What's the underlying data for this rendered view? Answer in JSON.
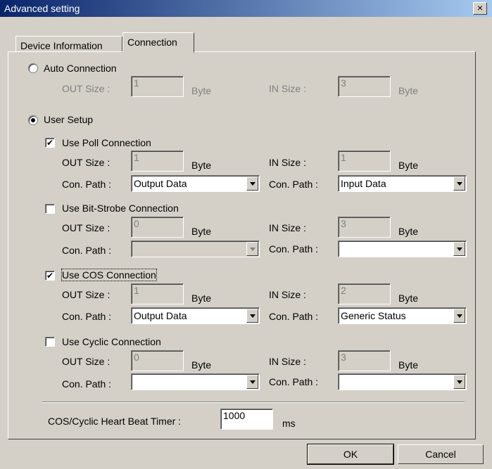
{
  "window": {
    "title": "Advanced setting",
    "close_label": "×"
  },
  "tabs": [
    {
      "label": "Device Information"
    },
    {
      "label": "Connection"
    }
  ],
  "auto": {
    "label": "Auto Connection",
    "selected": false,
    "out_label": "OUT Size :",
    "out_value": "1",
    "out_unit": "Byte",
    "in_label": "IN Size :",
    "in_value": "3",
    "in_unit": "Byte"
  },
  "user": {
    "label": "User Setup",
    "selected": true
  },
  "poll": {
    "label": "Use Poll Connection",
    "checked": true,
    "out_label": "OUT Size :",
    "out_value": "1",
    "out_unit": "Byte",
    "in_label": "IN Size :",
    "in_value": "1",
    "in_unit": "Byte",
    "path_label": "Con. Path :",
    "out_path": "Output Data",
    "in_path_label": "Con. Path :",
    "in_path": "Input Data"
  },
  "bitstrobe": {
    "label": "Use Bit-Strobe Connection",
    "checked": false,
    "out_label": "OUT Size :",
    "out_value": "0",
    "out_unit": "Byte",
    "in_label": "IN Size :",
    "in_value": "3",
    "in_unit": "Byte",
    "path_label": "Con. Path :",
    "out_path": "",
    "in_path_label": "Con. Path :",
    "in_path": ""
  },
  "cos": {
    "label": "Use COS Connection",
    "checked": true,
    "out_label": "OUT Size :",
    "out_value": "1",
    "out_unit": "Byte",
    "in_label": "IN Size :",
    "in_value": "2",
    "in_unit": "Byte",
    "path_label": "Con. Path :",
    "out_path": "Output Data",
    "in_path_label": "Con. Path :",
    "in_path": "Generic Status"
  },
  "cyclic": {
    "label": "Use Cyclic Connection",
    "checked": false,
    "out_label": "OUT Size :",
    "out_value": "0",
    "out_unit": "Byte",
    "in_label": "IN Size :",
    "in_value": "3",
    "in_unit": "Byte",
    "path_label": "Con. Path :",
    "out_path": "",
    "in_path_label": "Con. Path :",
    "in_path": ""
  },
  "timer": {
    "label": "COS/Cyclic Heart Beat Timer :",
    "value": "1000",
    "unit": "ms"
  },
  "buttons": {
    "ok": "OK",
    "cancel": "Cancel"
  }
}
